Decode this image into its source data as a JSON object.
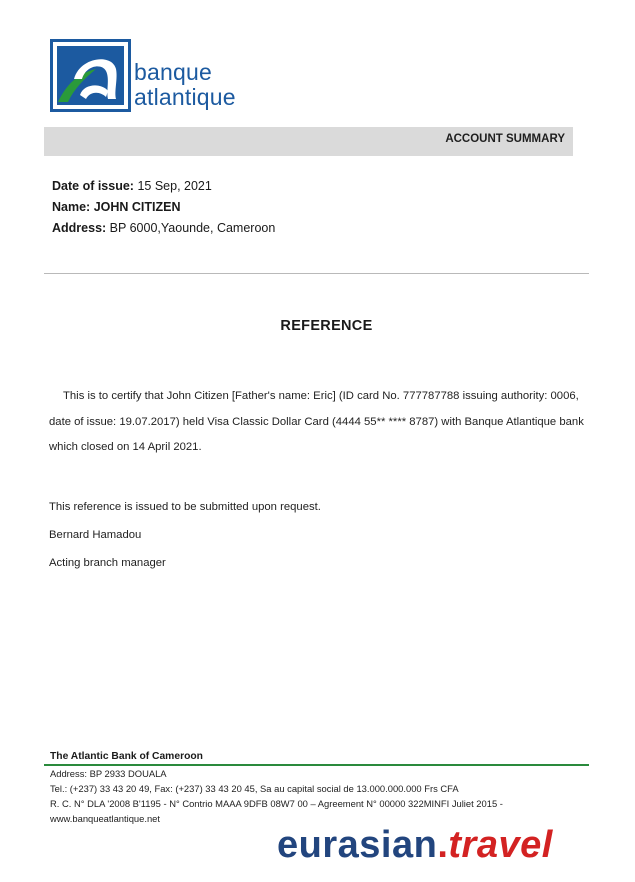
{
  "logo": {
    "line1": "banque",
    "line2": "atlantique",
    "colors": {
      "blue": "#1c5aa0",
      "green": "#2a9a3a"
    }
  },
  "header": {
    "summary_label": "ACCOUNT SUMMARY"
  },
  "info": {
    "date_label": "Date of issue:",
    "date_value": "15 Sep, 2021",
    "name_label": "Name:",
    "name_value": "JOHN CITIZEN",
    "address_label": "Address:",
    "address_value": "BP 6000,Yaounde, Cameroon"
  },
  "title": "REFERENCE",
  "body": {
    "paragraph": "This is to certify that John Citizen [Father's name: Eric] (ID card No. 777787788 issuing authority: 0006, date of issue: 19.07.2017) held Visa Classic Dollar Card (4444 55** **** 8787) with Banque Atlantique bank which closed on 14 April 2021.",
    "statement": "This reference is issued to be submitted upon request.",
    "signer": "Bernard Hamadou",
    "signer_title": "Acting branch manager"
  },
  "footer": {
    "bank_name": "The Atlantic Bank of Cameroon",
    "address": "Address: BP 2933 DOUALA",
    "contact": "Tel.: (+237) 33 43 20 49, Fax: (+237) 33 43 20 45, Sa au capital social de 13.000.000.000 Frs CFA",
    "registration": "R. C. N° DLA '2008 B'1195 - N° Contrio MAAA 9DFB 08W7 00 – Agreement N° 00000 322MINFI Juliet 2015 -",
    "website": "www.banqueatlantique.net"
  },
  "watermark": {
    "name": "eurasian",
    "dot": ".",
    "tld": "travel",
    "colors": {
      "name": "#22457e",
      "tld": "#d32222"
    }
  }
}
